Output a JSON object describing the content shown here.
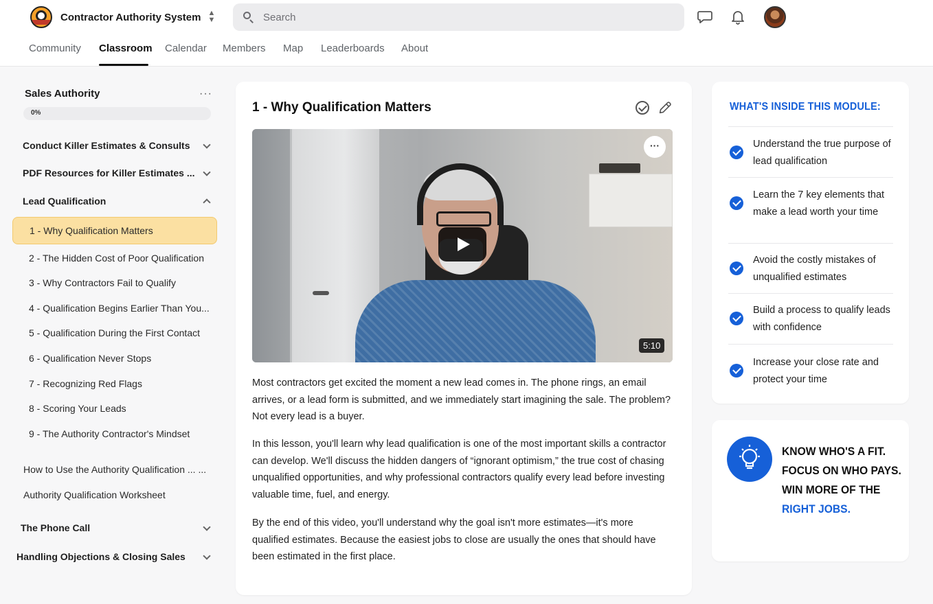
{
  "app": {
    "name": "Contractor Authority System",
    "search_placeholder": "Search"
  },
  "nav": {
    "tabs": [
      "Community",
      "Classroom",
      "Calendar",
      "Members",
      "Map",
      "Leaderboards",
      "About"
    ],
    "active": "Classroom"
  },
  "sidebar": {
    "course_title": "Sales Authority",
    "more": "···",
    "progress_label": "0%",
    "progress": 0,
    "sections": [
      {
        "label": "Conduct Killer Estimates & Consults",
        "expanded": false
      },
      {
        "label": "PDF Resources for Killer Estimates ...",
        "expanded": false
      },
      {
        "label": "Lead Qualification",
        "expanded": true
      }
    ],
    "lessons": [
      "1 - Why Qualification Matters",
      "2 - The Hidden Cost of Poor Qualification",
      "3 - Why Contractors Fail to Qualify",
      "4 - Qualification Begins Earlier Than You...",
      "5 - Qualification During the First Contact",
      "6 - Qualification Never Stops",
      "7 - Recognizing Red Flags",
      "8 - Scoring Your Leads",
      "9 - The Authority Contractor's Mindset"
    ],
    "resources": [
      "How to Use the Authority Qualification ... ...",
      "Authority Qualification Worksheet"
    ],
    "bottom_sections": [
      {
        "label": "The Phone Call",
        "expanded": false
      },
      {
        "label": "Handling Objections & Closing Sales",
        "expanded": false
      }
    ]
  },
  "lesson": {
    "title": "1 - Why Qualification Matters",
    "video_duration": "5:10",
    "video_more": "···",
    "paragraphs": [
      "Most contractors get excited the moment a new lead comes in. The phone rings, an email arrives, or a lead form is submitted, and we immediately start imagining the sale. The problem? Not every lead is a buyer.",
      "In this lesson, you'll learn why lead qualification is one of the most important skills a contractor can develop. We'll discuss the hidden dangers of “ignorant optimism,” the true cost of chasing unqualified opportunities, and why professional contractors qualify every lead before investing valuable time, fuel, and energy.",
      "By the end of this video, you'll understand why the goal isn't more estimates—it's more qualified estimates. Because the easiest jobs to close are usually the ones that should have been estimated in the first place."
    ]
  },
  "module": {
    "heading": "WHAT'S INSIDE THIS MODULE:",
    "items": [
      "Understand the true purpose of lead qualification",
      "Learn the 7 key elements that make a lead worth your time",
      "Avoid the costly mistakes of unqualified estimates",
      "Build a process to qualify leads with confidence",
      "Increase your close rate and protect your time"
    ]
  },
  "promo": {
    "line1": "KNOW WHO'S A FIT.",
    "line2": "FOCUS ON WHO PAYS.",
    "line3": "WIN MORE OF THE",
    "line4": "RIGHT JOBS."
  },
  "colors": {
    "accent": "#1660d8",
    "active_lesson_bg": "#fbe0a2"
  }
}
